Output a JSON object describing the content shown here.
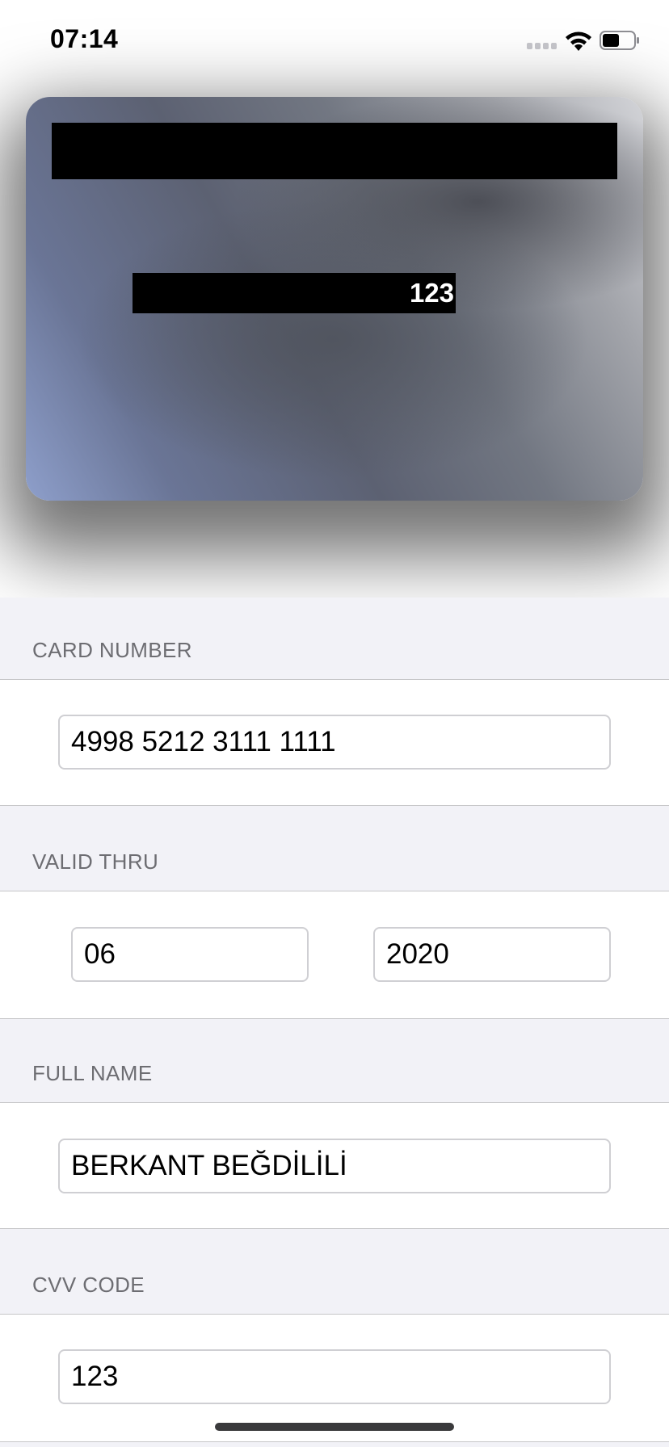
{
  "status_bar": {
    "time": "07:14"
  },
  "card": {
    "cvv": "123",
    "gradient_colors": [
      "#8e9fcb",
      "#5c6172",
      "#d3d4d8"
    ]
  },
  "form": {
    "card_number": {
      "label": "CARD NUMBER",
      "value": "4998 5212 3111 1111"
    },
    "valid_thru": {
      "label": "VALID THRU",
      "month": "06",
      "year": "2020"
    },
    "full_name": {
      "label": "FULL NAME",
      "value": "BERKANT BEĞDİLİLİ"
    },
    "cvv_code": {
      "label": "CVV CODE",
      "value": "123"
    }
  },
  "icons": {
    "signal": "signal-icon",
    "wifi": "wifi-icon",
    "battery": "battery-icon"
  }
}
